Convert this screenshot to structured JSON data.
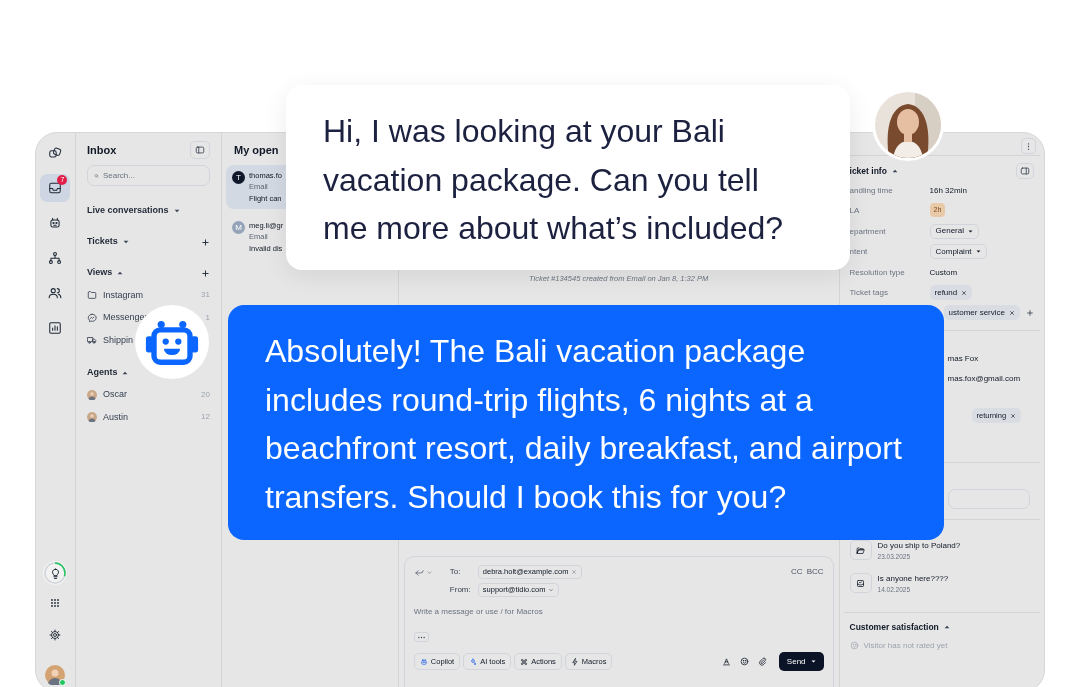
{
  "rail": {
    "items": [
      {
        "kind": "logo",
        "selected": false
      },
      {
        "kind": "inbox",
        "selected": true,
        "badge": "7"
      },
      {
        "kind": "bot",
        "selected": false
      },
      {
        "kind": "network",
        "selected": false
      },
      {
        "kind": "users",
        "selected": false
      },
      {
        "kind": "chart",
        "selected": false
      }
    ],
    "bottom": [
      {
        "kind": "bulb"
      },
      {
        "kind": "grid"
      },
      {
        "kind": "settings"
      },
      {
        "kind": "avatar",
        "online": true
      }
    ]
  },
  "inbox": {
    "title": "Inbox",
    "search": {
      "placeholder": "Search..."
    },
    "sections": [
      {
        "title": "Live conversations",
        "expanded": false,
        "addable": false
      },
      {
        "title": "Tickets",
        "expanded": false,
        "addable": true
      },
      {
        "title": "Views",
        "expanded": true,
        "addable": true,
        "items": [
          {
            "kind": "folder",
            "label": "Instagram",
            "count": "31"
          },
          {
            "kind": "messenger",
            "label": "Messenger",
            "count": "1"
          },
          {
            "kind": "truck",
            "label": "Shippin"
          }
        ]
      },
      {
        "title": "Agents",
        "expanded": true,
        "addable": false,
        "items": [
          {
            "kind": "avatar",
            "label": "Oscar",
            "count": "20"
          },
          {
            "kind": "avatar",
            "label": "Austin",
            "count": "12"
          }
        ]
      }
    ]
  },
  "conversations": {
    "title": "My open",
    "items": [
      {
        "initial": "T",
        "color": "#0f172a",
        "sender": "thomas.fo",
        "channel": "Email",
        "preview": "Flight can",
        "selected": true
      },
      {
        "initial": "M",
        "color": "#94a3b8",
        "sender": "meg.li@gr",
        "channel": "Email",
        "preview": "Invalid dis",
        "selected": false
      }
    ]
  },
  "thread": {
    "system_note": "Ticket #134545 created from Email on Jan 8, 1:32 PM"
  },
  "composer": {
    "to_label": "To:",
    "to": "debra.holt@example.com",
    "from_label": "From:",
    "from": "support@tidio.com",
    "cc": "CC",
    "bcc": "BCC",
    "placeholder": "Write a message or use / for Macros",
    "tools": [
      {
        "kind": "copilot",
        "label": "Copilot"
      },
      {
        "kind": "ai",
        "label": "AI tools"
      },
      {
        "kind": "actions",
        "label": "Actions"
      },
      {
        "kind": "macros",
        "label": "Macros"
      }
    ],
    "send": "Send"
  },
  "ticket_info": {
    "title": "icket info",
    "expanded": true,
    "fields": [
      {
        "kind": "text",
        "label": "andling time",
        "value": "16h 32min"
      },
      {
        "kind": "badge",
        "label": "LA",
        "value": "2h"
      },
      {
        "kind": "select",
        "label": "epartment",
        "value": "General"
      },
      {
        "kind": "select",
        "label": "ntent",
        "value": "Complaint"
      },
      {
        "kind": "text",
        "label": "Resolution type",
        "value": "Custom"
      },
      {
        "kind": "tags",
        "label": "Ticket tags",
        "tags": [
          "refund",
          "ustomer service"
        ]
      }
    ]
  },
  "contact": {
    "name": "mas Fox",
    "email": "mas.fox@gmail.com",
    "tags": [
      "returning"
    ]
  },
  "previous": [
    {
      "kind": "folder",
      "title": "Do you ship to Poland?",
      "date": "23.03.2025"
    },
    {
      "kind": "inbox",
      "title": "Is anyone here????",
      "date": "14.02.2025"
    }
  ],
  "satisfaction": {
    "title": "Customer satisfaction",
    "expanded": true,
    "text": "Visitor has not rated yet"
  },
  "customer_message": "Hi, I was looking at your Bali vacation package. Can you tell me more about what’s included?",
  "bot_message": "Absolutely! The Bali vacation package includes round-trip flights, 6 nights at a beachfront resort, daily breakfast, and airport transfers. Should I book this for you?"
}
